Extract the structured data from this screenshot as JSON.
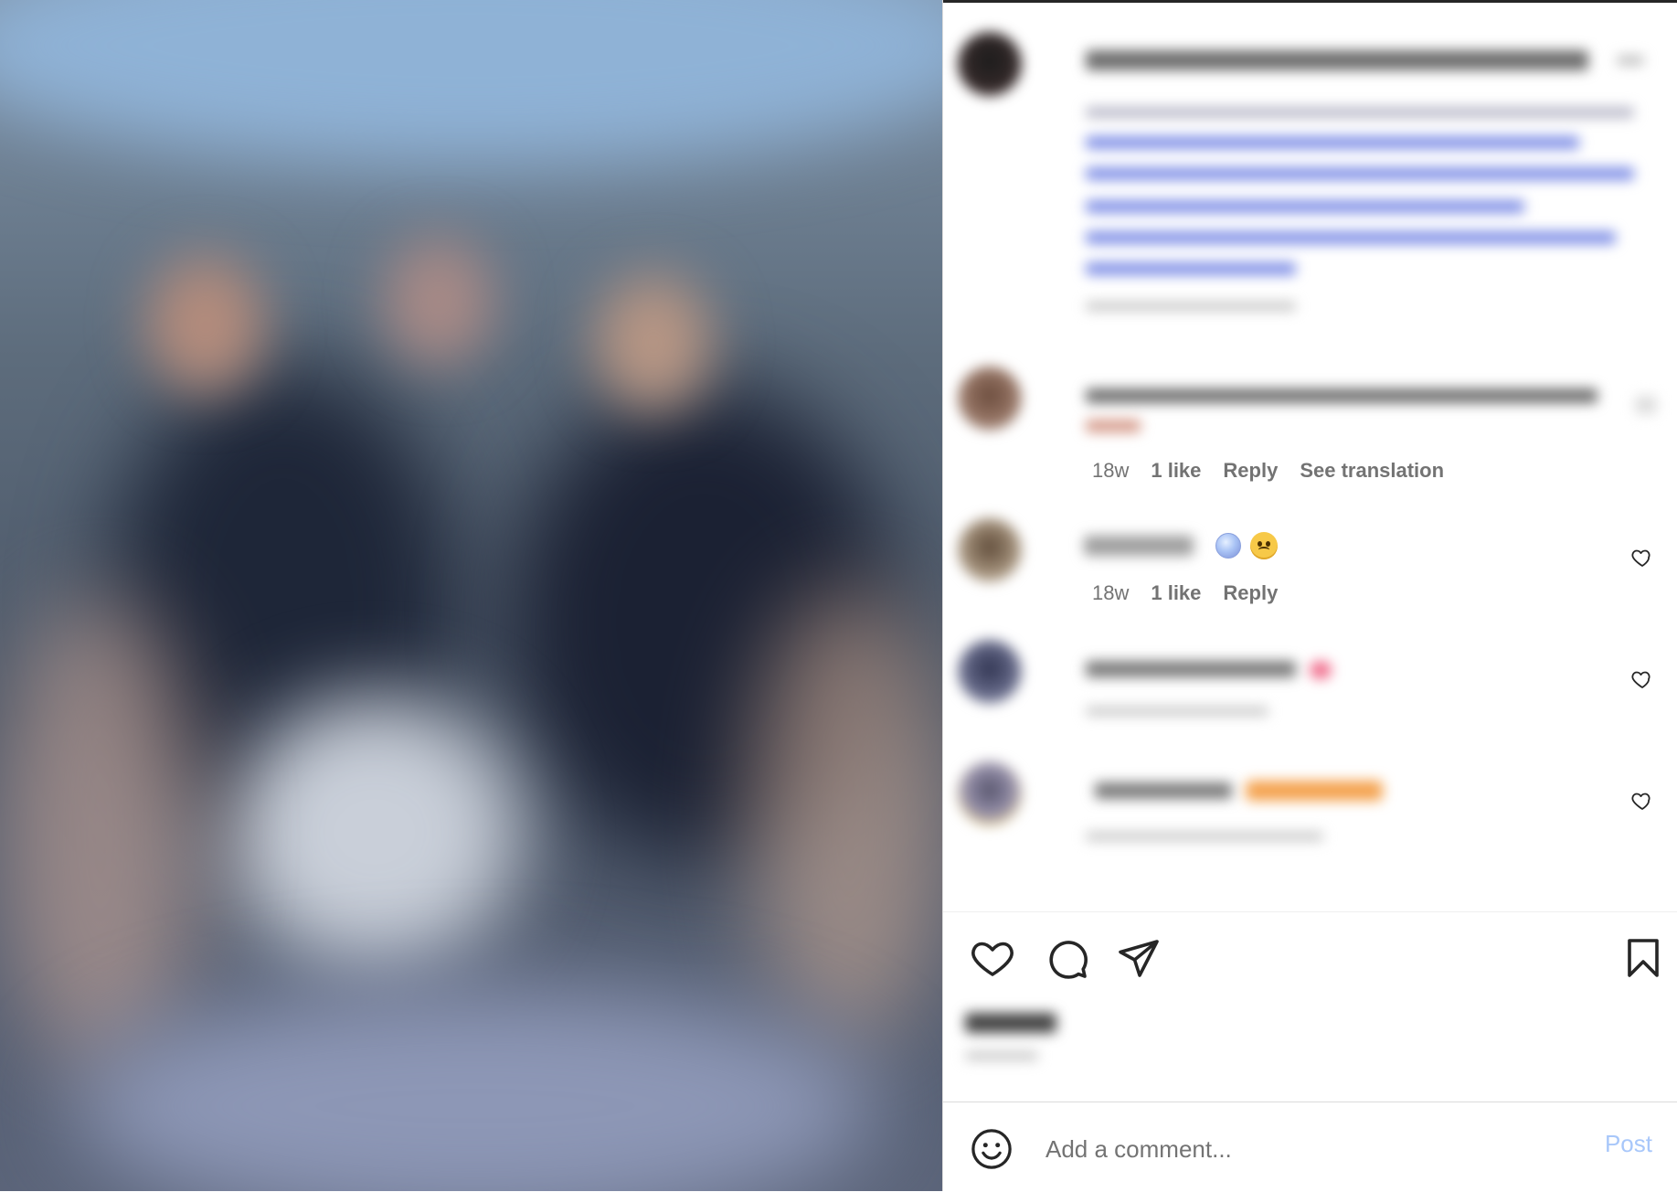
{
  "post": {
    "likes_label": "",
    "date_label": ""
  },
  "comments": [
    {
      "time": "18w",
      "likes": "1 like",
      "reply": "Reply",
      "translate": "See translation"
    },
    {
      "time": "18w",
      "likes": "1 like",
      "reply": "Reply",
      "emojis": [
        "globe-emoji",
        "woozy-face-emoji"
      ]
    },
    {
      "blurred": true
    },
    {
      "blurred": true
    }
  ],
  "actions": {
    "like": "heart-icon",
    "comment": "comment-bubble-icon",
    "share": "paper-plane-icon",
    "save": "bookmark-icon"
  },
  "composer": {
    "placeholder": "Add a comment...",
    "post_label": "Post",
    "post_color": "#a8c7fa",
    "emoji_icon": "smiley-icon"
  },
  "colors": {
    "secondary_text": "#737373",
    "divider": "#dbdbdb",
    "link_blue": "#00376b"
  }
}
